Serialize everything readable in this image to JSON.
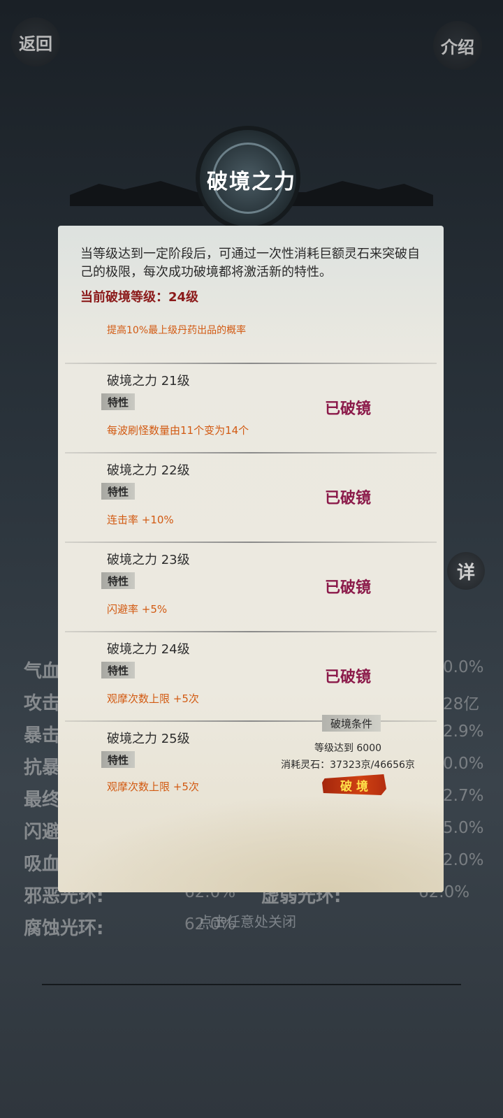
{
  "top": {
    "back_label": "返回",
    "intro_label": "介绍",
    "detail_label": "详"
  },
  "dialog": {
    "title": "破境之力",
    "intro": "当等级达到一定阶段后，可通过一次性消耗巨额灵石来突破自己的极限，每次成功破境都将激活新的特性。",
    "current_level": "当前破境等级：24级",
    "prev_desc": "提高10%最上级丹药出品的概率",
    "levels": [
      {
        "name": "破境之力 21级",
        "trait": "特性",
        "desc": "每波刷怪数量由11个变为14个",
        "status": "已破镜"
      },
      {
        "name": "破境之力 22级",
        "trait": "特性",
        "desc": "连击率 +10%",
        "status": "已破镜"
      },
      {
        "name": "破境之力 23级",
        "trait": "特性",
        "desc": "闪避率 +5%",
        "status": "已破镜"
      },
      {
        "name": "破境之力 24级",
        "trait": "特性",
        "desc": "观摩次数上限 +5次",
        "status": "已破镜"
      },
      {
        "name": "破境之力 25级",
        "trait": "特性",
        "desc": "观摩次数上限 +5次"
      }
    ],
    "condition_title": "破境条件",
    "condition_level": "等级达到 6000",
    "condition_cost": "消耗灵石：37323京/46656京",
    "break_button": "破 境"
  },
  "background_stats": {
    "labels": [
      "气血",
      "攻击",
      "暴击",
      "抗暴",
      "最终",
      "闪避",
      "吸血",
      "邪恶光环:",
      "腐蚀光环:",
      "虚弱光环:"
    ],
    "values": [
      "0.0%",
      "28亿",
      "2.9%",
      "0.0%",
      "2.7%",
      "5.0%",
      "2.0%",
      "62.0%",
      "62.0%",
      "62.0%"
    ]
  },
  "close_hint": "点击任意处关闭"
}
